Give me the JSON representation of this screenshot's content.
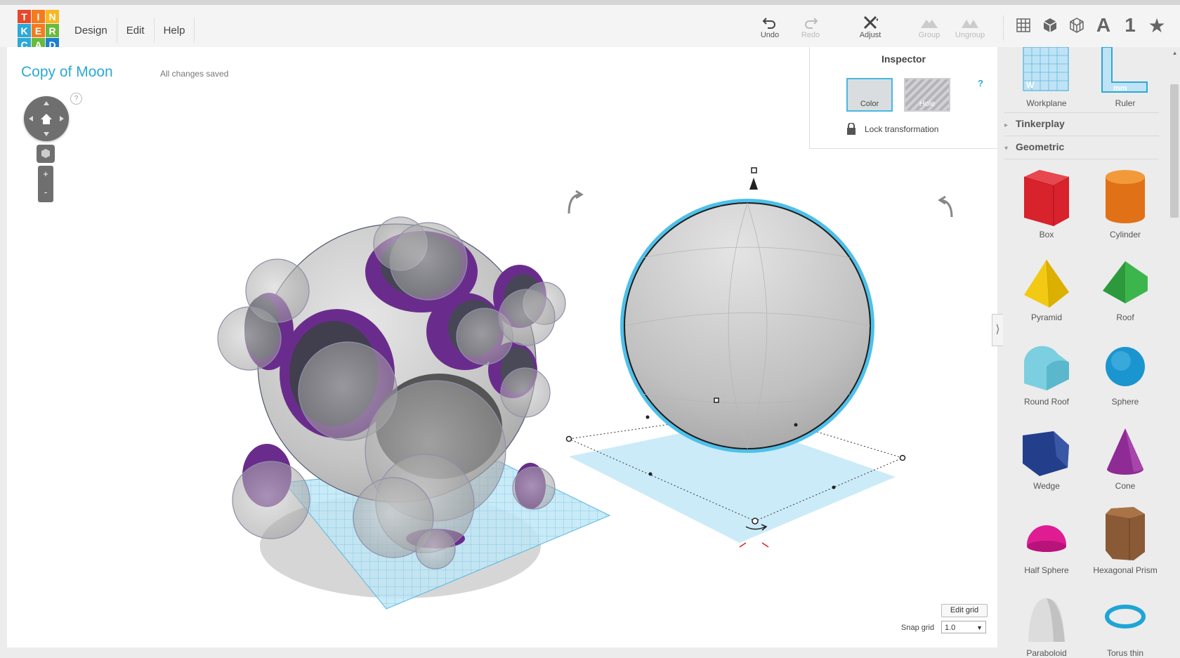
{
  "logo": {
    "letters": [
      "T",
      "I",
      "N",
      "K",
      "E",
      "R",
      "C",
      "A",
      "D"
    ],
    "colors": [
      "#e8472a",
      "#f47b20",
      "#f8b820",
      "#2ea8d6",
      "#f47b20",
      "#6aba3d",
      "#2ea8d6",
      "#6aba3d",
      "#1d7fd1"
    ]
  },
  "menu": {
    "items": [
      "Design",
      "Edit",
      "Help"
    ]
  },
  "toolbar": {
    "undo": "Undo",
    "redo": "Redo",
    "adjust": "Adjust",
    "group": "Group",
    "ungroup": "Ungroup",
    "view_icons": [
      "grid-view-icon",
      "cube-view-icon",
      "wireframe-view-icon",
      "text-icon",
      "number-icon",
      "star-icon"
    ],
    "text_label": "A",
    "number_label": "1",
    "star_label": "★"
  },
  "document": {
    "title": "Copy of Moon",
    "status": "All changes saved"
  },
  "nav": {
    "help": "?",
    "zoom_in": "+",
    "zoom_out": "-"
  },
  "inspector": {
    "title": "Inspector",
    "color_label": "Color",
    "hole_label": "Hole",
    "help": "?",
    "lock_label": "Lock transformation"
  },
  "sidebar": {
    "top_items": [
      {
        "label": "Workplane",
        "icon": "workplane-icon"
      },
      {
        "label": "Ruler",
        "icon": "ruler-icon"
      }
    ],
    "sections": [
      {
        "label": "Tinkerplay",
        "expanded": false
      },
      {
        "label": "Geometric",
        "expanded": true
      }
    ],
    "shapes": [
      "Box",
      "Cylinder",
      "Pyramid",
      "Roof",
      "Round Roof",
      "Sphere",
      "Wedge",
      "Cone",
      "Half Sphere",
      "Hexagonal Prism",
      "Paraboloid",
      "Torus thin"
    ]
  },
  "grid": {
    "edit_label": "Edit grid",
    "snap_label": "Snap grid",
    "snap_value": "1.0"
  },
  "colors": {
    "accent": "#2ca9d6",
    "crater": "#6a2c8c",
    "selection": "#4ec0ea"
  }
}
